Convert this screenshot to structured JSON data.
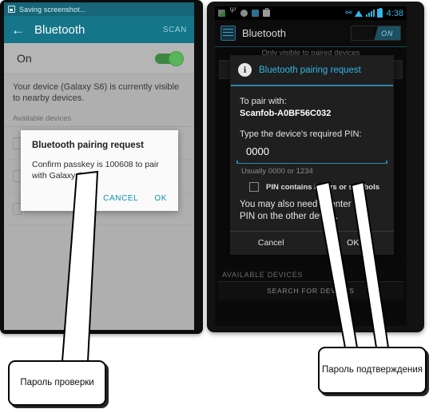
{
  "left_phone": {
    "status_bar": {
      "icon": "screenshot-icon",
      "text": "Saving screenshot..."
    },
    "app_bar": {
      "back_icon": "back-arrow-icon",
      "title": "Bluetooth",
      "action": "SCAN"
    },
    "toggle_row": {
      "label": "On",
      "state": "on"
    },
    "visible_note": "Your device (Galaxy S6) is currently visible to nearby devices.",
    "section_header": "Available devices",
    "dialog": {
      "title": "Bluetooth pairing request",
      "message": "Confirm passkey is 100608 to pair with Galaxy S5.",
      "passkey": "100608",
      "device": "Galaxy S5",
      "cancel": "CANCEL",
      "ok": "OK"
    }
  },
  "right_phone": {
    "status_bar": {
      "notification_icons": [
        "image-icon",
        "usb-icon",
        "sync-icon",
        "app-icon",
        "briefcase-icon"
      ],
      "system_icons": [
        "bluetooth-icon",
        "wifi-icon",
        "signal-icon",
        "battery-icon"
      ],
      "time": "4:38"
    },
    "action_bar": {
      "icon": "settings-icon",
      "title": "Bluetooth",
      "switch_label": "ON"
    },
    "visible_note": "Only visible to paired devices",
    "available_devices": "AVAILABLE DEVICES",
    "search_button": "SEARCH FOR DEVICES",
    "dialog": {
      "icon": "info-icon",
      "title": "Bluetooth pairing request",
      "pair_label": "To pair with:",
      "device_name": "Scanfob-A0BF56C032",
      "pin_prompt": "Type the device's required PIN:",
      "pin_value": "0000",
      "pin_hint": "Usually 0000 or 1234",
      "checkbox_label": "PIN contains letters or symbols",
      "checkbox_checked": false,
      "note": "You may also need to enter this PIN on the other device.",
      "cancel": "Cancel",
      "ok": "OK"
    }
  },
  "callouts": {
    "left": "Пароль проверки",
    "right": "Пароль подтверждения"
  },
  "colors": {
    "left_header_teal": "#16798c",
    "left_status_teal": "#17697a",
    "left_accent_link": "#0c93b5",
    "toggle_green": "#5cb85c",
    "holo_blue": "#33b5e5",
    "holo_rule": "#2e89ad",
    "screen_grey": "#b3b3b3"
  }
}
